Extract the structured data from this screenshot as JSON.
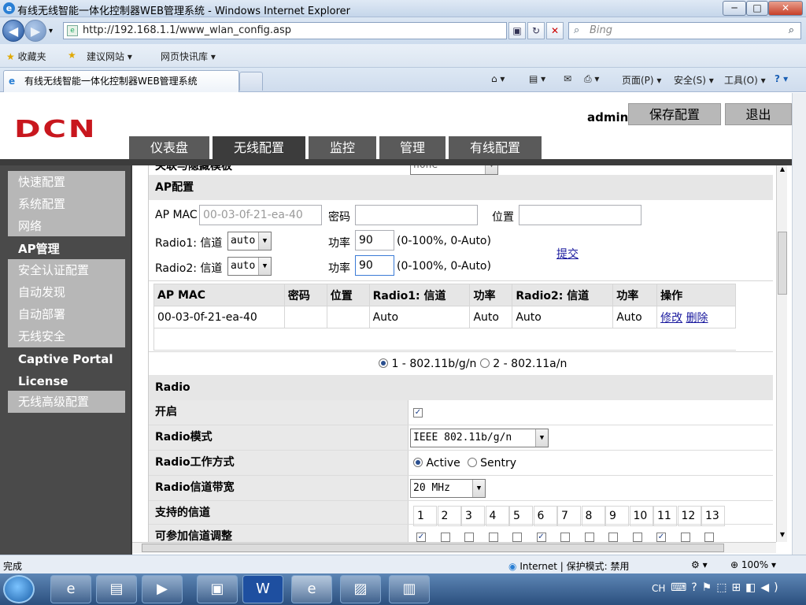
{
  "window": {
    "title": "有线无线智能一体化控制器WEB管理系统 - Windows Internet Explorer",
    "min": "─",
    "max": "□",
    "close": "✕"
  },
  "browser": {
    "back": "◀",
    "forward": "▶",
    "url": "http://192.168.1.1/www_wlan_config.asp",
    "search_placeholder": "Bing",
    "favorites": "收藏夹",
    "suggested_sites": "建议网站 ▾",
    "web_slices": "网页快讯库 ▾",
    "tab_title": "有线无线智能一体化控制器WEB管理系统",
    "commands": {
      "page": "页面(P) ▾",
      "safety": "安全(S) ▾",
      "tools": "工具(O) ▾",
      "help": "? ▾"
    }
  },
  "header": {
    "logo": "DCN",
    "user": "admin",
    "save": "保存配置",
    "logout": "退出"
  },
  "nav_tabs": [
    "仪表盘",
    "无线配置",
    "监控",
    "管理",
    "有线配置"
  ],
  "sidebar": [
    "快速配置",
    "系统配置",
    "网络",
    "AP管理",
    "安全认证配置",
    "自动发现",
    "自动部署",
    "无线安全",
    "Captive Portal",
    "License",
    "无线高级配置"
  ],
  "content": {
    "cut_label": "关联与隐藏模板",
    "cut_value": "none",
    "ap_section": "AP配置",
    "ap_mac_label": "AP MAC",
    "ap_mac_placeholder": "00-03-0f-21-ea-40",
    "password_label": "密码",
    "location_label": "位置",
    "radio1_label": "Radio1: 信道",
    "radio1_channel": "auto",
    "radio2_label": "Radio2: 信道",
    "radio2_channel": "auto",
    "power_label": "功率",
    "radio1_power": "90",
    "radio2_power": "90",
    "power_hint": "(0-100%, 0-Auto)",
    "submit": "提交",
    "table_headers": [
      "AP MAC",
      "密码",
      "位置",
      "Radio1: 信道",
      "功率",
      "Radio2: 信道",
      "功率",
      "操作"
    ],
    "table_rows": [
      {
        "mac": "00-03-0f-21-ea-40",
        "password": "",
        "location": "",
        "r1_channel": "Auto",
        "r1_power": "Auto",
        "r2_channel": "Auto",
        "r2_power": "Auto",
        "edit": "修改",
        "delete": "删除"
      }
    ],
    "band_options": [
      "1 - 802.11b/g/n",
      "2 - 802.11a/n"
    ],
    "radio_section": "Radio",
    "enable_label": "开启",
    "mode_label": "Radio模式",
    "mode_value": "IEEE 802.11b/g/n",
    "work_label": "Radio工作方式",
    "work_options": [
      "Active",
      "Sentry"
    ],
    "bandwidth_label": "Radio信道带宽",
    "bandwidth_value": "20 MHz",
    "channels_label": "支持的信道",
    "channels": [
      "1",
      "2",
      "3",
      "4",
      "5",
      "6",
      "7",
      "8",
      "9",
      "10",
      "11",
      "12",
      "13"
    ],
    "channels_checked": [
      true,
      false,
      false,
      false,
      false,
      true,
      false,
      false,
      false,
      false,
      true,
      false,
      false
    ],
    "adjust_label": "可参加信道调整"
  },
  "status": {
    "left": "完成",
    "zone": "Internet | 保护模式: 禁用",
    "zoom": "100%"
  },
  "tray": {
    "lang": "CH"
  }
}
